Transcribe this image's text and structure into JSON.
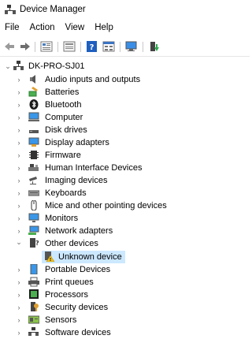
{
  "window": {
    "title": "Device Manager"
  },
  "menu": [
    "File",
    "Action",
    "View",
    "Help"
  ],
  "tree": {
    "root": "DK-PRO-SJ01",
    "items": [
      {
        "label": "Audio inputs and outputs",
        "icon": "speaker-icon"
      },
      {
        "label": "Batteries",
        "icon": "battery-icon"
      },
      {
        "label": "Bluetooth",
        "icon": "bluetooth-icon"
      },
      {
        "label": "Computer",
        "icon": "computer-icon"
      },
      {
        "label": "Disk drives",
        "icon": "disk-drive-icon"
      },
      {
        "label": "Display adapters",
        "icon": "display-adapter-icon"
      },
      {
        "label": "Firmware",
        "icon": "firmware-icon"
      },
      {
        "label": "Human Interface Devices",
        "icon": "hid-icon"
      },
      {
        "label": "Imaging devices",
        "icon": "camera-icon"
      },
      {
        "label": "Keyboards",
        "icon": "keyboard-icon"
      },
      {
        "label": "Mice and other pointing devices",
        "icon": "mouse-icon"
      },
      {
        "label": "Monitors",
        "icon": "monitor-icon"
      },
      {
        "label": "Network adapters",
        "icon": "network-icon"
      },
      {
        "label": "Other devices",
        "icon": "other-devices-icon",
        "expanded": true
      },
      {
        "label": "Unknown device",
        "icon": "warning-device-icon",
        "child": true,
        "selected": true
      },
      {
        "label": "Portable Devices",
        "icon": "portable-device-icon"
      },
      {
        "label": "Print queues",
        "icon": "printer-icon"
      },
      {
        "label": "Processors",
        "icon": "processor-icon"
      },
      {
        "label": "Security devices",
        "icon": "security-icon"
      },
      {
        "label": "Sensors",
        "icon": "sensor-icon"
      },
      {
        "label": "Software devices",
        "icon": "software-icon"
      }
    ]
  },
  "colors": {
    "selection": "#cce8ff",
    "accent": "#1e78d7"
  }
}
